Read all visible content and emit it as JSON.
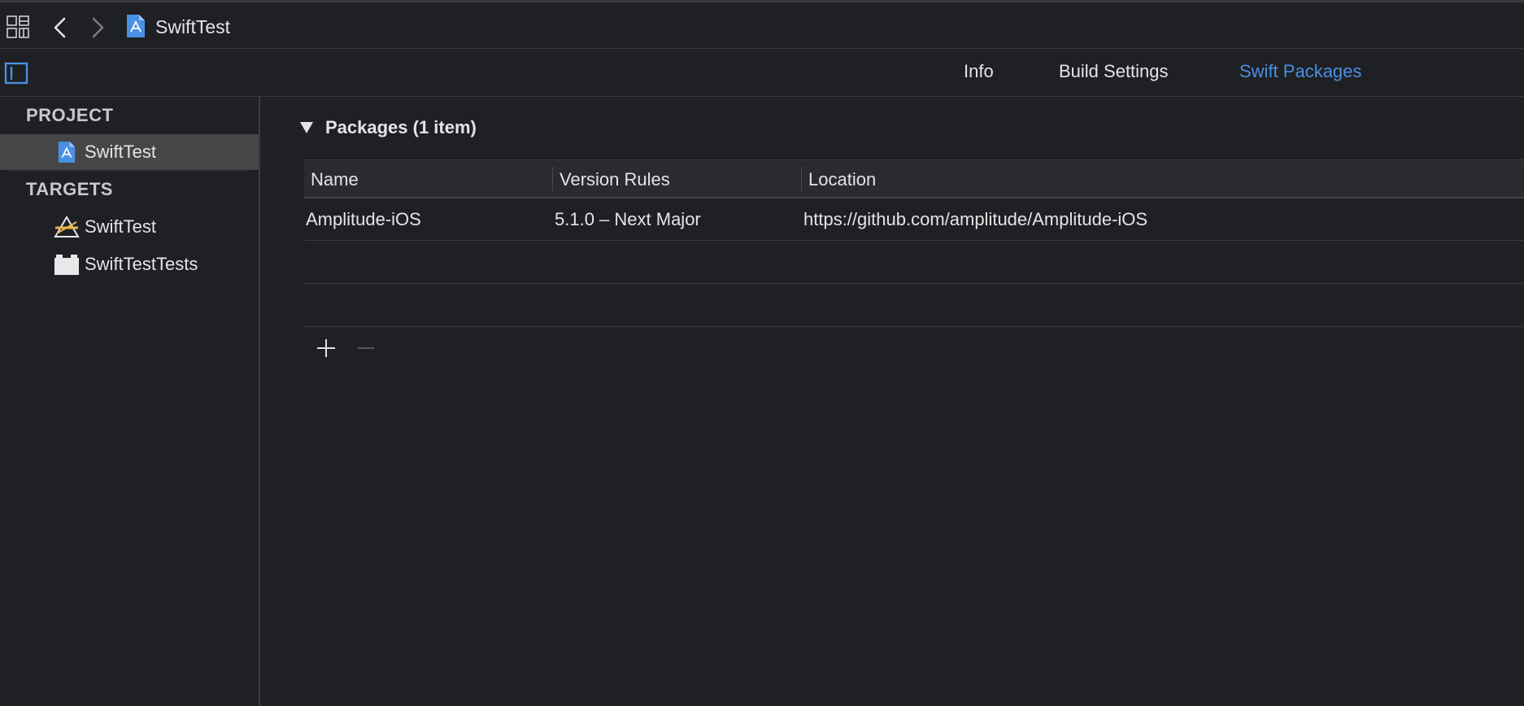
{
  "nav": {
    "title": "SwiftTest"
  },
  "tabs": [
    {
      "label": "Info",
      "active": false
    },
    {
      "label": "Build Settings",
      "active": false
    },
    {
      "label": "Swift Packages",
      "active": true
    }
  ],
  "sidebar": {
    "project_header": "PROJECT",
    "project_items": [
      {
        "label": "SwiftTest",
        "icon": "project-file-icon",
        "selected": true
      }
    ],
    "targets_header": "TARGETS",
    "target_items": [
      {
        "label": "SwiftTest",
        "icon": "app-target-icon"
      },
      {
        "label": "SwiftTestTests",
        "icon": "test-bundle-icon"
      }
    ]
  },
  "packages": {
    "title": "Packages (1 item)",
    "columns": [
      "Name",
      "Version Rules",
      "Location"
    ],
    "rows": [
      {
        "name": "Amplitude-iOS",
        "version": "5.1.0 – Next Major",
        "location": "https://github.com/amplitude/Amplitude-iOS"
      }
    ]
  },
  "colors": {
    "accent": "#4a90e2",
    "background": "#1f2024",
    "selection": "#464649"
  }
}
